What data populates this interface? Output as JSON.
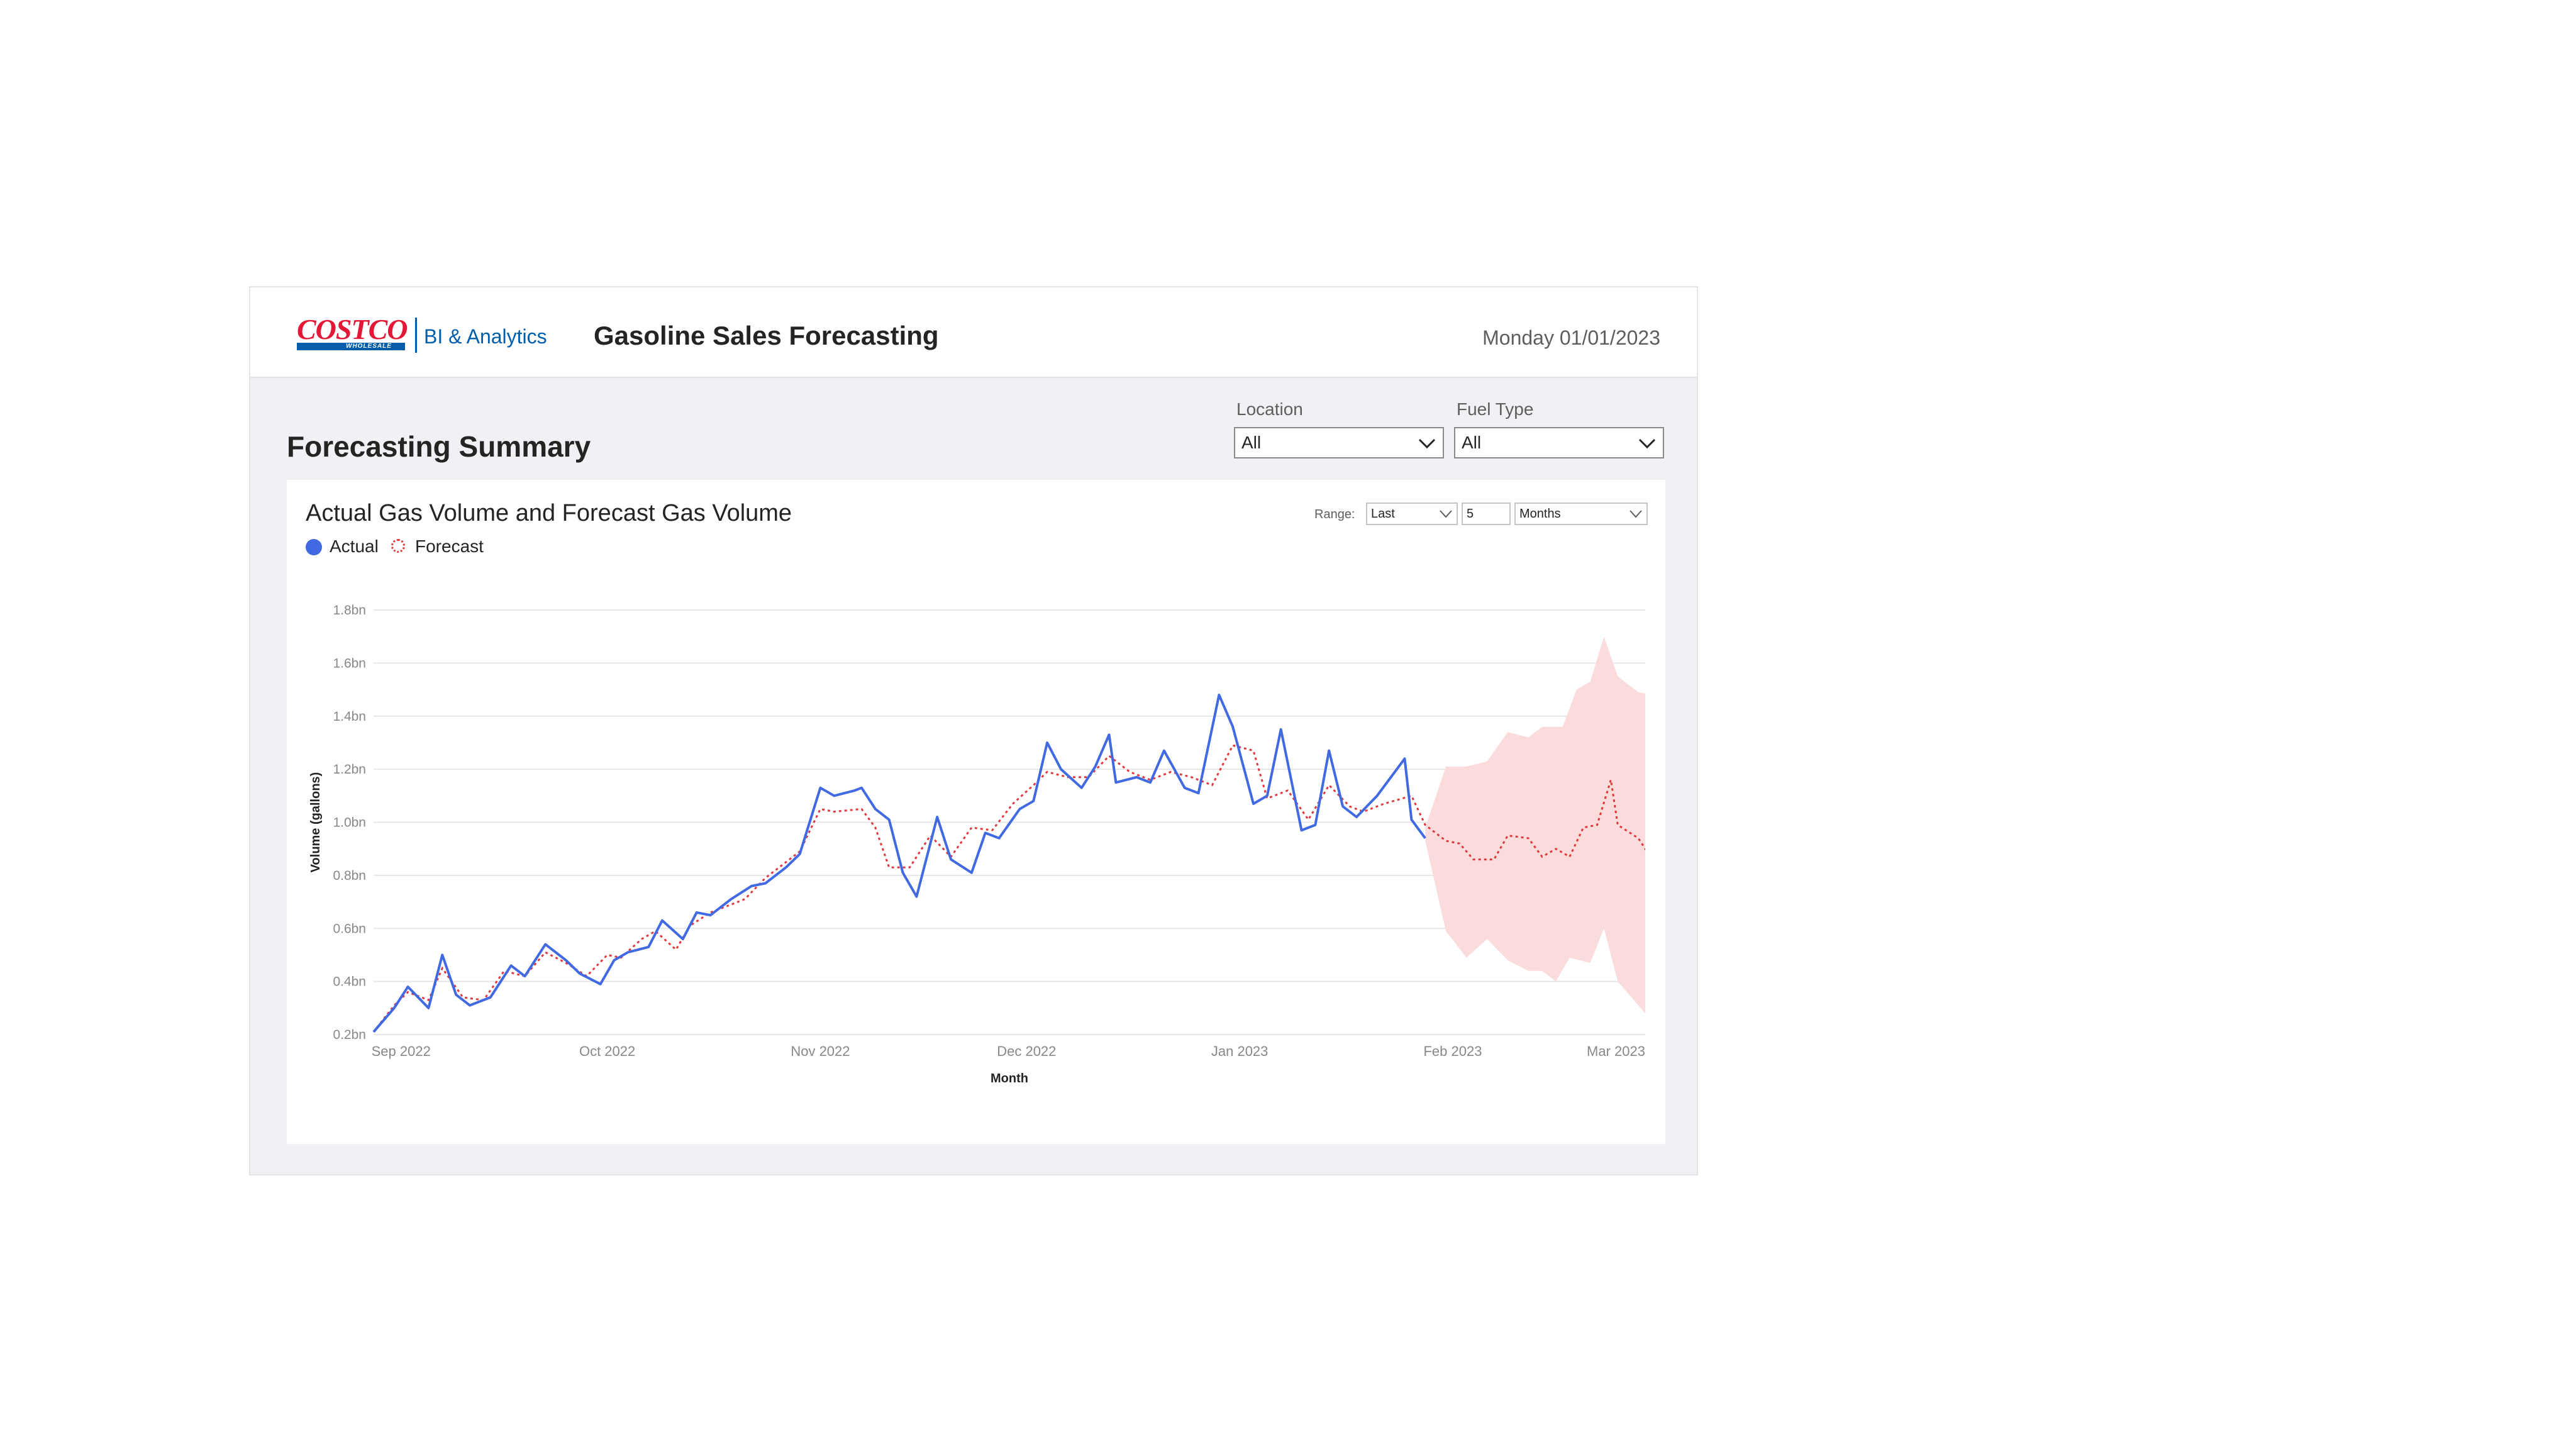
{
  "header": {
    "logo_text": "COSTCO",
    "logo_subtext": "WHOLESALE",
    "product_label": "BI & Analytics",
    "app_title": "Gasoline Sales Forecasting",
    "date": "Monday 01/01/2023"
  },
  "page": {
    "section_title": "Forecasting Summary"
  },
  "filters": {
    "location": {
      "label": "Location",
      "value": "All"
    },
    "fuel_type": {
      "label": "Fuel Type",
      "value": "All"
    }
  },
  "chart_card": {
    "title": "Actual Gas Volume and Forecast Gas Volume",
    "legend": [
      {
        "label": "Actual",
        "color": "#4169e1",
        "style": "solid-dot"
      },
      {
        "label": "Forecast",
        "color": "#e0393e",
        "style": "dotted-circle"
      }
    ],
    "range": {
      "label": "Range:",
      "mode": "Last",
      "count": "5",
      "unit": "Months"
    }
  },
  "colors": {
    "actual": "#4169e1",
    "forecast": "#e0393e",
    "band": "#fbdcdc",
    "brand_red": "#e31837",
    "brand_blue": "#005daa"
  },
  "icons": [
    "chevron-down-icon"
  ],
  "chart_data": {
    "type": "line",
    "xlabel": "Month",
    "ylabel": "Volume (gallons)",
    "ylim": [
      0.2,
      1.8
    ],
    "yticks": [
      0.2,
      0.4,
      0.6,
      0.8,
      1.0,
      1.2,
      1.4,
      1.6,
      1.8
    ],
    "ytick_labels": [
      "0.2bn",
      "0.4bn",
      "0.6bn",
      "0.8bn",
      "1.0bn",
      "1.2bn",
      "1.4bn",
      "1.6bn",
      "1.8bn"
    ],
    "xlim": [
      "2022-08-28",
      "2023-03-01"
    ],
    "xticks": [
      {
        "label": "Sep 2022",
        "date": "2022-09-01"
      },
      {
        "label": "Oct 2022",
        "date": "2022-10-01"
      },
      {
        "label": "Nov 2022",
        "date": "2022-11-01"
      },
      {
        "label": "Dec 2022",
        "date": "2022-12-01"
      },
      {
        "label": "Jan 2023",
        "date": "2023-01-01"
      },
      {
        "label": "Feb 2023",
        "date": "2023-02-01"
      },
      {
        "label": "Mar 2023",
        "date": "2023-03-01"
      }
    ],
    "grid": true,
    "legend_position": "top-left",
    "series": [
      {
        "name": "Actual",
        "points": [
          [
            "2022-08-28",
            0.21
          ],
          [
            "2022-08-31",
            0.3
          ],
          [
            "2022-09-02",
            0.38
          ],
          [
            "2022-09-05",
            0.3
          ],
          [
            "2022-09-07",
            0.5
          ],
          [
            "2022-09-09",
            0.35
          ],
          [
            "2022-09-11",
            0.31
          ],
          [
            "2022-09-14",
            0.34
          ],
          [
            "2022-09-17",
            0.46
          ],
          [
            "2022-09-19",
            0.42
          ],
          [
            "2022-09-22",
            0.54
          ],
          [
            "2022-09-25",
            0.48
          ],
          [
            "2022-09-27",
            0.43
          ],
          [
            "2022-09-30",
            0.39
          ],
          [
            "2022-10-02",
            0.48
          ],
          [
            "2022-10-04",
            0.51
          ],
          [
            "2022-10-07",
            0.53
          ],
          [
            "2022-10-09",
            0.63
          ],
          [
            "2022-10-12",
            0.56
          ],
          [
            "2022-10-14",
            0.66
          ],
          [
            "2022-10-16",
            0.65
          ],
          [
            "2022-10-19",
            0.71
          ],
          [
            "2022-10-22",
            0.76
          ],
          [
            "2022-10-24",
            0.77
          ],
          [
            "2022-10-27",
            0.83
          ],
          [
            "2022-10-29",
            0.88
          ],
          [
            "2022-11-01",
            1.13
          ],
          [
            "2022-11-03",
            1.1
          ],
          [
            "2022-11-06",
            1.12
          ],
          [
            "2022-11-07",
            1.13
          ],
          [
            "2022-11-09",
            1.05
          ],
          [
            "2022-11-11",
            1.01
          ],
          [
            "2022-11-13",
            0.81
          ],
          [
            "2022-11-15",
            0.72
          ],
          [
            "2022-11-18",
            1.02
          ],
          [
            "2022-11-20",
            0.86
          ],
          [
            "2022-11-23",
            0.81
          ],
          [
            "2022-11-25",
            0.96
          ],
          [
            "2022-11-27",
            0.94
          ],
          [
            "2022-11-30",
            1.05
          ],
          [
            "2022-12-02",
            1.08
          ],
          [
            "2022-12-04",
            1.3
          ],
          [
            "2022-12-06",
            1.2
          ],
          [
            "2022-12-09",
            1.13
          ],
          [
            "2022-12-11",
            1.21
          ],
          [
            "2022-12-13",
            1.33
          ],
          [
            "2022-12-14",
            1.15
          ],
          [
            "2022-12-17",
            1.17
          ],
          [
            "2022-12-19",
            1.15
          ],
          [
            "2022-12-21",
            1.27
          ],
          [
            "2022-12-24",
            1.13
          ],
          [
            "2022-12-26",
            1.11
          ],
          [
            "2022-12-29",
            1.48
          ],
          [
            "2022-12-31",
            1.36
          ],
          [
            "2023-01-03",
            1.07
          ],
          [
            "2023-01-05",
            1.1
          ],
          [
            "2023-01-07",
            1.35
          ],
          [
            "2023-01-10",
            0.97
          ],
          [
            "2023-01-12",
            0.99
          ],
          [
            "2023-01-14",
            1.27
          ],
          [
            "2023-01-16",
            1.06
          ],
          [
            "2023-01-18",
            1.02
          ],
          [
            "2023-01-21",
            1.1
          ],
          [
            "2023-01-25",
            1.24
          ],
          [
            "2023-01-26",
            1.01
          ],
          [
            "2023-01-28",
            0.94
          ]
        ]
      },
      {
        "name": "Forecast",
        "points": [
          [
            "2022-08-28",
            0.21
          ],
          [
            "2022-08-31",
            0.31
          ],
          [
            "2022-09-02",
            0.36
          ],
          [
            "2022-09-05",
            0.33
          ],
          [
            "2022-09-07",
            0.45
          ],
          [
            "2022-09-10",
            0.34
          ],
          [
            "2022-09-13",
            0.33
          ],
          [
            "2022-09-16",
            0.44
          ],
          [
            "2022-09-19",
            0.42
          ],
          [
            "2022-09-22",
            0.51
          ],
          [
            "2022-09-25",
            0.47
          ],
          [
            "2022-09-28",
            0.42
          ],
          [
            "2022-10-01",
            0.5
          ],
          [
            "2022-10-03",
            0.49
          ],
          [
            "2022-10-06",
            0.56
          ],
          [
            "2022-10-08",
            0.59
          ],
          [
            "2022-10-11",
            0.52
          ],
          [
            "2022-10-13",
            0.61
          ],
          [
            "2022-10-16",
            0.66
          ],
          [
            "2022-10-19",
            0.69
          ],
          [
            "2022-10-21",
            0.71
          ],
          [
            "2022-10-24",
            0.79
          ],
          [
            "2022-10-27",
            0.85
          ],
          [
            "2022-10-29",
            0.89
          ],
          [
            "2022-11-01",
            1.05
          ],
          [
            "2022-11-03",
            1.04
          ],
          [
            "2022-11-07",
            1.05
          ],
          [
            "2022-11-09",
            0.98
          ],
          [
            "2022-11-11",
            0.83
          ],
          [
            "2022-11-14",
            0.83
          ],
          [
            "2022-11-17",
            0.95
          ],
          [
            "2022-11-20",
            0.87
          ],
          [
            "2022-11-23",
            0.98
          ],
          [
            "2022-11-26",
            0.97
          ],
          [
            "2022-11-29",
            1.07
          ],
          [
            "2022-12-02",
            1.14
          ],
          [
            "2022-12-04",
            1.19
          ],
          [
            "2022-12-07",
            1.17
          ],
          [
            "2022-12-10",
            1.17
          ],
          [
            "2022-12-13",
            1.25
          ],
          [
            "2022-12-16",
            1.19
          ],
          [
            "2022-12-19",
            1.16
          ],
          [
            "2022-12-22",
            1.19
          ],
          [
            "2022-12-25",
            1.17
          ],
          [
            "2022-12-28",
            1.14
          ],
          [
            "2022-12-31",
            1.29
          ],
          [
            "2023-01-03",
            1.27
          ],
          [
            "2023-01-05",
            1.09
          ],
          [
            "2023-01-08",
            1.12
          ],
          [
            "2023-01-11",
            1.01
          ],
          [
            "2023-01-14",
            1.14
          ],
          [
            "2023-01-17",
            1.06
          ],
          [
            "2023-01-19",
            1.04
          ],
          [
            "2023-01-22",
            1.07
          ],
          [
            "2023-01-26",
            1.1
          ],
          [
            "2023-01-28",
            0.99
          ],
          [
            "2023-01-31",
            0.93
          ],
          [
            "2023-02-02",
            0.92
          ],
          [
            "2023-02-04",
            0.86
          ],
          [
            "2023-02-07",
            0.86
          ],
          [
            "2023-02-09",
            0.95
          ],
          [
            "2023-02-12",
            0.94
          ],
          [
            "2023-02-14",
            0.87
          ],
          [
            "2023-02-16",
            0.9
          ],
          [
            "2023-02-18",
            0.87
          ],
          [
            "2023-02-20",
            0.98
          ],
          [
            "2023-02-22",
            0.99
          ],
          [
            "2023-02-24",
            1.16
          ],
          [
            "2023-02-25",
            0.99
          ],
          [
            "2023-02-28",
            0.94
          ],
          [
            "2023-03-02",
            0.86
          ],
          [
            "2023-03-04",
            0.86
          ],
          [
            "2023-03-07",
            0.94
          ],
          [
            "2023-03-10",
            0.92
          ],
          [
            "2023-03-12",
            0.87
          ]
        ]
      }
    ],
    "confidence_band": {
      "upper": [
        [
          "2023-01-28",
          0.98
        ],
        [
          "2023-01-31",
          1.21
        ],
        [
          "2023-02-03",
          1.21
        ],
        [
          "2023-02-06",
          1.23
        ],
        [
          "2023-02-09",
          1.34
        ],
        [
          "2023-02-12",
          1.32
        ],
        [
          "2023-02-14",
          1.36
        ],
        [
          "2023-02-17",
          1.36
        ],
        [
          "2023-02-19",
          1.5
        ],
        [
          "2023-02-21",
          1.53
        ],
        [
          "2023-02-23",
          1.7
        ],
        [
          "2023-02-25",
          1.55
        ],
        [
          "2023-02-28",
          1.49
        ],
        [
          "2023-03-02",
          1.48
        ],
        [
          "2023-03-05",
          1.59
        ],
        [
          "2023-03-07",
          1.59
        ],
        [
          "2023-03-12",
          1.56
        ]
      ],
      "lower": [
        [
          "2023-01-28",
          0.93
        ],
        [
          "2023-01-31",
          0.59
        ],
        [
          "2023-02-03",
          0.49
        ],
        [
          "2023-02-06",
          0.56
        ],
        [
          "2023-02-09",
          0.48
        ],
        [
          "2023-02-12",
          0.44
        ],
        [
          "2023-02-14",
          0.44
        ],
        [
          "2023-02-16",
          0.4
        ],
        [
          "2023-02-18",
          0.49
        ],
        [
          "2023-02-21",
          0.47
        ],
        [
          "2023-02-23",
          0.6
        ],
        [
          "2023-02-25",
          0.4
        ],
        [
          "2023-02-28",
          0.31
        ],
        [
          "2023-03-02",
          0.25
        ],
        [
          "2023-03-04",
          0.24
        ],
        [
          "2023-03-07",
          0.31
        ],
        [
          "2023-03-12",
          0.21
        ]
      ]
    }
  }
}
